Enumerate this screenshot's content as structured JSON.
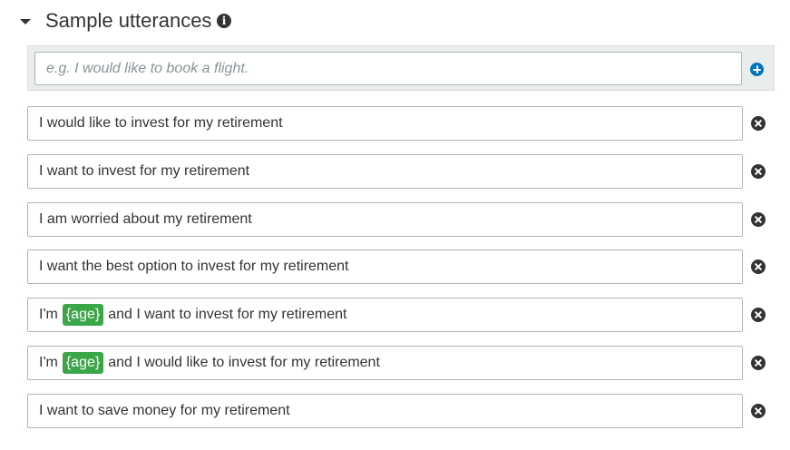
{
  "section": {
    "title": "Sample utterances",
    "info_icon": "info-icon",
    "collapse_icon": "caret-down-icon"
  },
  "add": {
    "placeholder": "e.g. I would like to book a flight.",
    "icon": "plus-circle-icon",
    "color": "#0073bb"
  },
  "slot_color": "#3aa648",
  "utterances": [
    {
      "before": "I would like to invest for my retirement",
      "slot": "",
      "after": ""
    },
    {
      "before": "I want to invest for my retirement",
      "slot": "",
      "after": ""
    },
    {
      "before": "I am worried about my retirement",
      "slot": "",
      "after": ""
    },
    {
      "before": "I want the best option to invest for my retirement",
      "slot": "",
      "after": ""
    },
    {
      "before": "I'm",
      "slot": "{age}",
      "after": "and I want to invest for my retirement"
    },
    {
      "before": "I'm",
      "slot": "{age}",
      "after": "and I would like to invest for my retirement"
    },
    {
      "before": "I want to save money for my retirement",
      "slot": "",
      "after": ""
    }
  ],
  "delete_icon": "close-circle-icon"
}
